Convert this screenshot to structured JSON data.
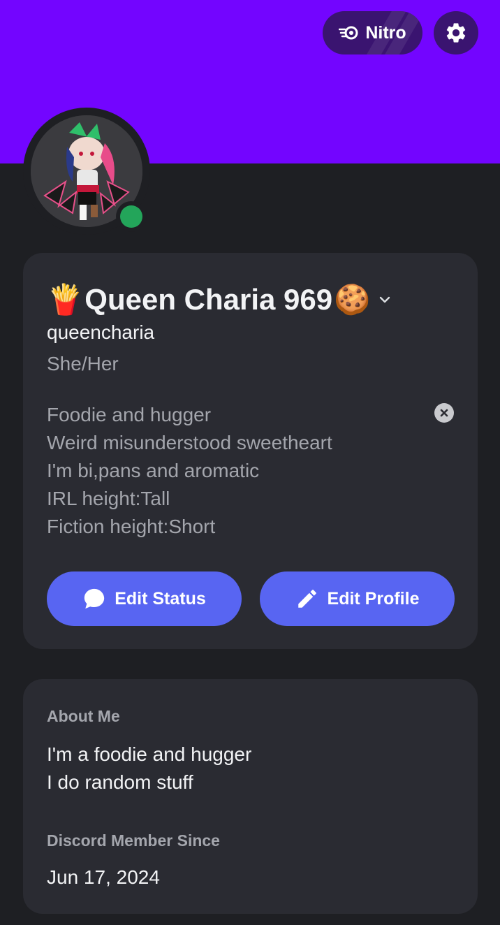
{
  "header": {
    "nitro_label": "Nitro",
    "nitro_icon": "nitro-icon",
    "settings_icon": "gear-icon",
    "banner_color": "#7305ff"
  },
  "avatar": {
    "status": "online",
    "status_color": "#23a55a"
  },
  "profile": {
    "display_name_prefix_emoji": "🍟",
    "display_name": "Queen Charia 969",
    "display_name_suffix_emoji": "🍪",
    "username": "queencharia",
    "pronouns": "She/Her",
    "bio_lines": [
      "Foodie and hugger",
      "Weird misunderstood sweetheart",
      "I'm bi,pans and aromatic",
      "IRL height:Tall",
      "Fiction height:Short"
    ],
    "edit_status_label": "Edit Status",
    "edit_profile_label": "Edit Profile",
    "accent_color": "#5865f2"
  },
  "about": {
    "title": "About Me",
    "lines": [
      "I'm a foodie and hugger",
      "I do random stuff"
    ],
    "member_since_title": "Discord Member Since",
    "member_since_date": "Jun 17, 2024"
  }
}
